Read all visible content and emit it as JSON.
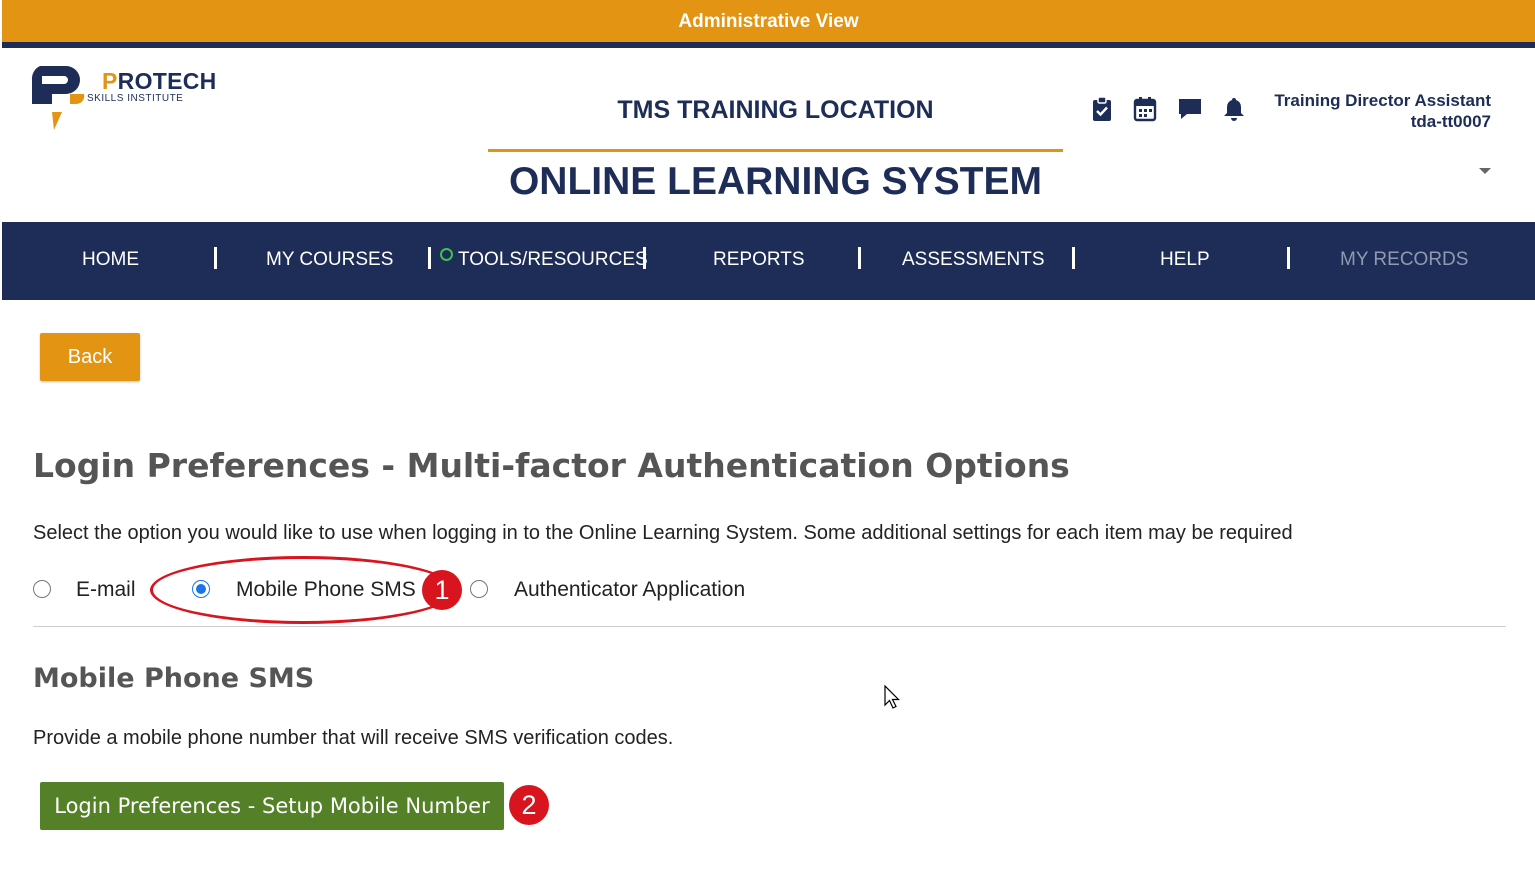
{
  "banner": {
    "text": "Administrative View"
  },
  "logo": {
    "brand_highlight": "P",
    "brand_rest": "ROTECH",
    "subtitle": "SKILLS INSTITUTE"
  },
  "header": {
    "location": "TMS TRAINING LOCATION",
    "system": "ONLINE LEARNING SYSTEM"
  },
  "header_icons": [
    "clipboard-check-icon",
    "calendar-icon",
    "chat-icon",
    "bell-icon"
  ],
  "user": {
    "role": "Training Director Assistant",
    "id": "tda-tt0007"
  },
  "nav": {
    "items": [
      "HOME",
      "MY COURSES",
      "TOOLS/RESOURCES",
      "REPORTS",
      "ASSESSMENTS",
      "HELP",
      "MY RECORDS"
    ],
    "disabled_item": "MY RECORDS"
  },
  "actions": {
    "back_label": "Back"
  },
  "page": {
    "title": "Login Preferences - Multi-factor Authentication Options",
    "intro": "Select the option you would like to use when logging in to the Online Learning System. Some additional settings for each item may be required"
  },
  "mfa_options": {
    "email": "E-mail",
    "sms": "Mobile Phone SMS",
    "authenticator": "Authenticator Application",
    "selected": "Mobile Phone SMS"
  },
  "sms_section": {
    "title": "Mobile Phone SMS",
    "description": "Provide a mobile phone number that will receive SMS verification codes.",
    "button_label": "Login Preferences - Setup Mobile Number"
  },
  "annotations": {
    "step1": "1",
    "step2": "2"
  },
  "colors": {
    "accent": "#e39412",
    "navy": "#1d2d57",
    "green": "#548127",
    "annotation": "#d8151f"
  }
}
